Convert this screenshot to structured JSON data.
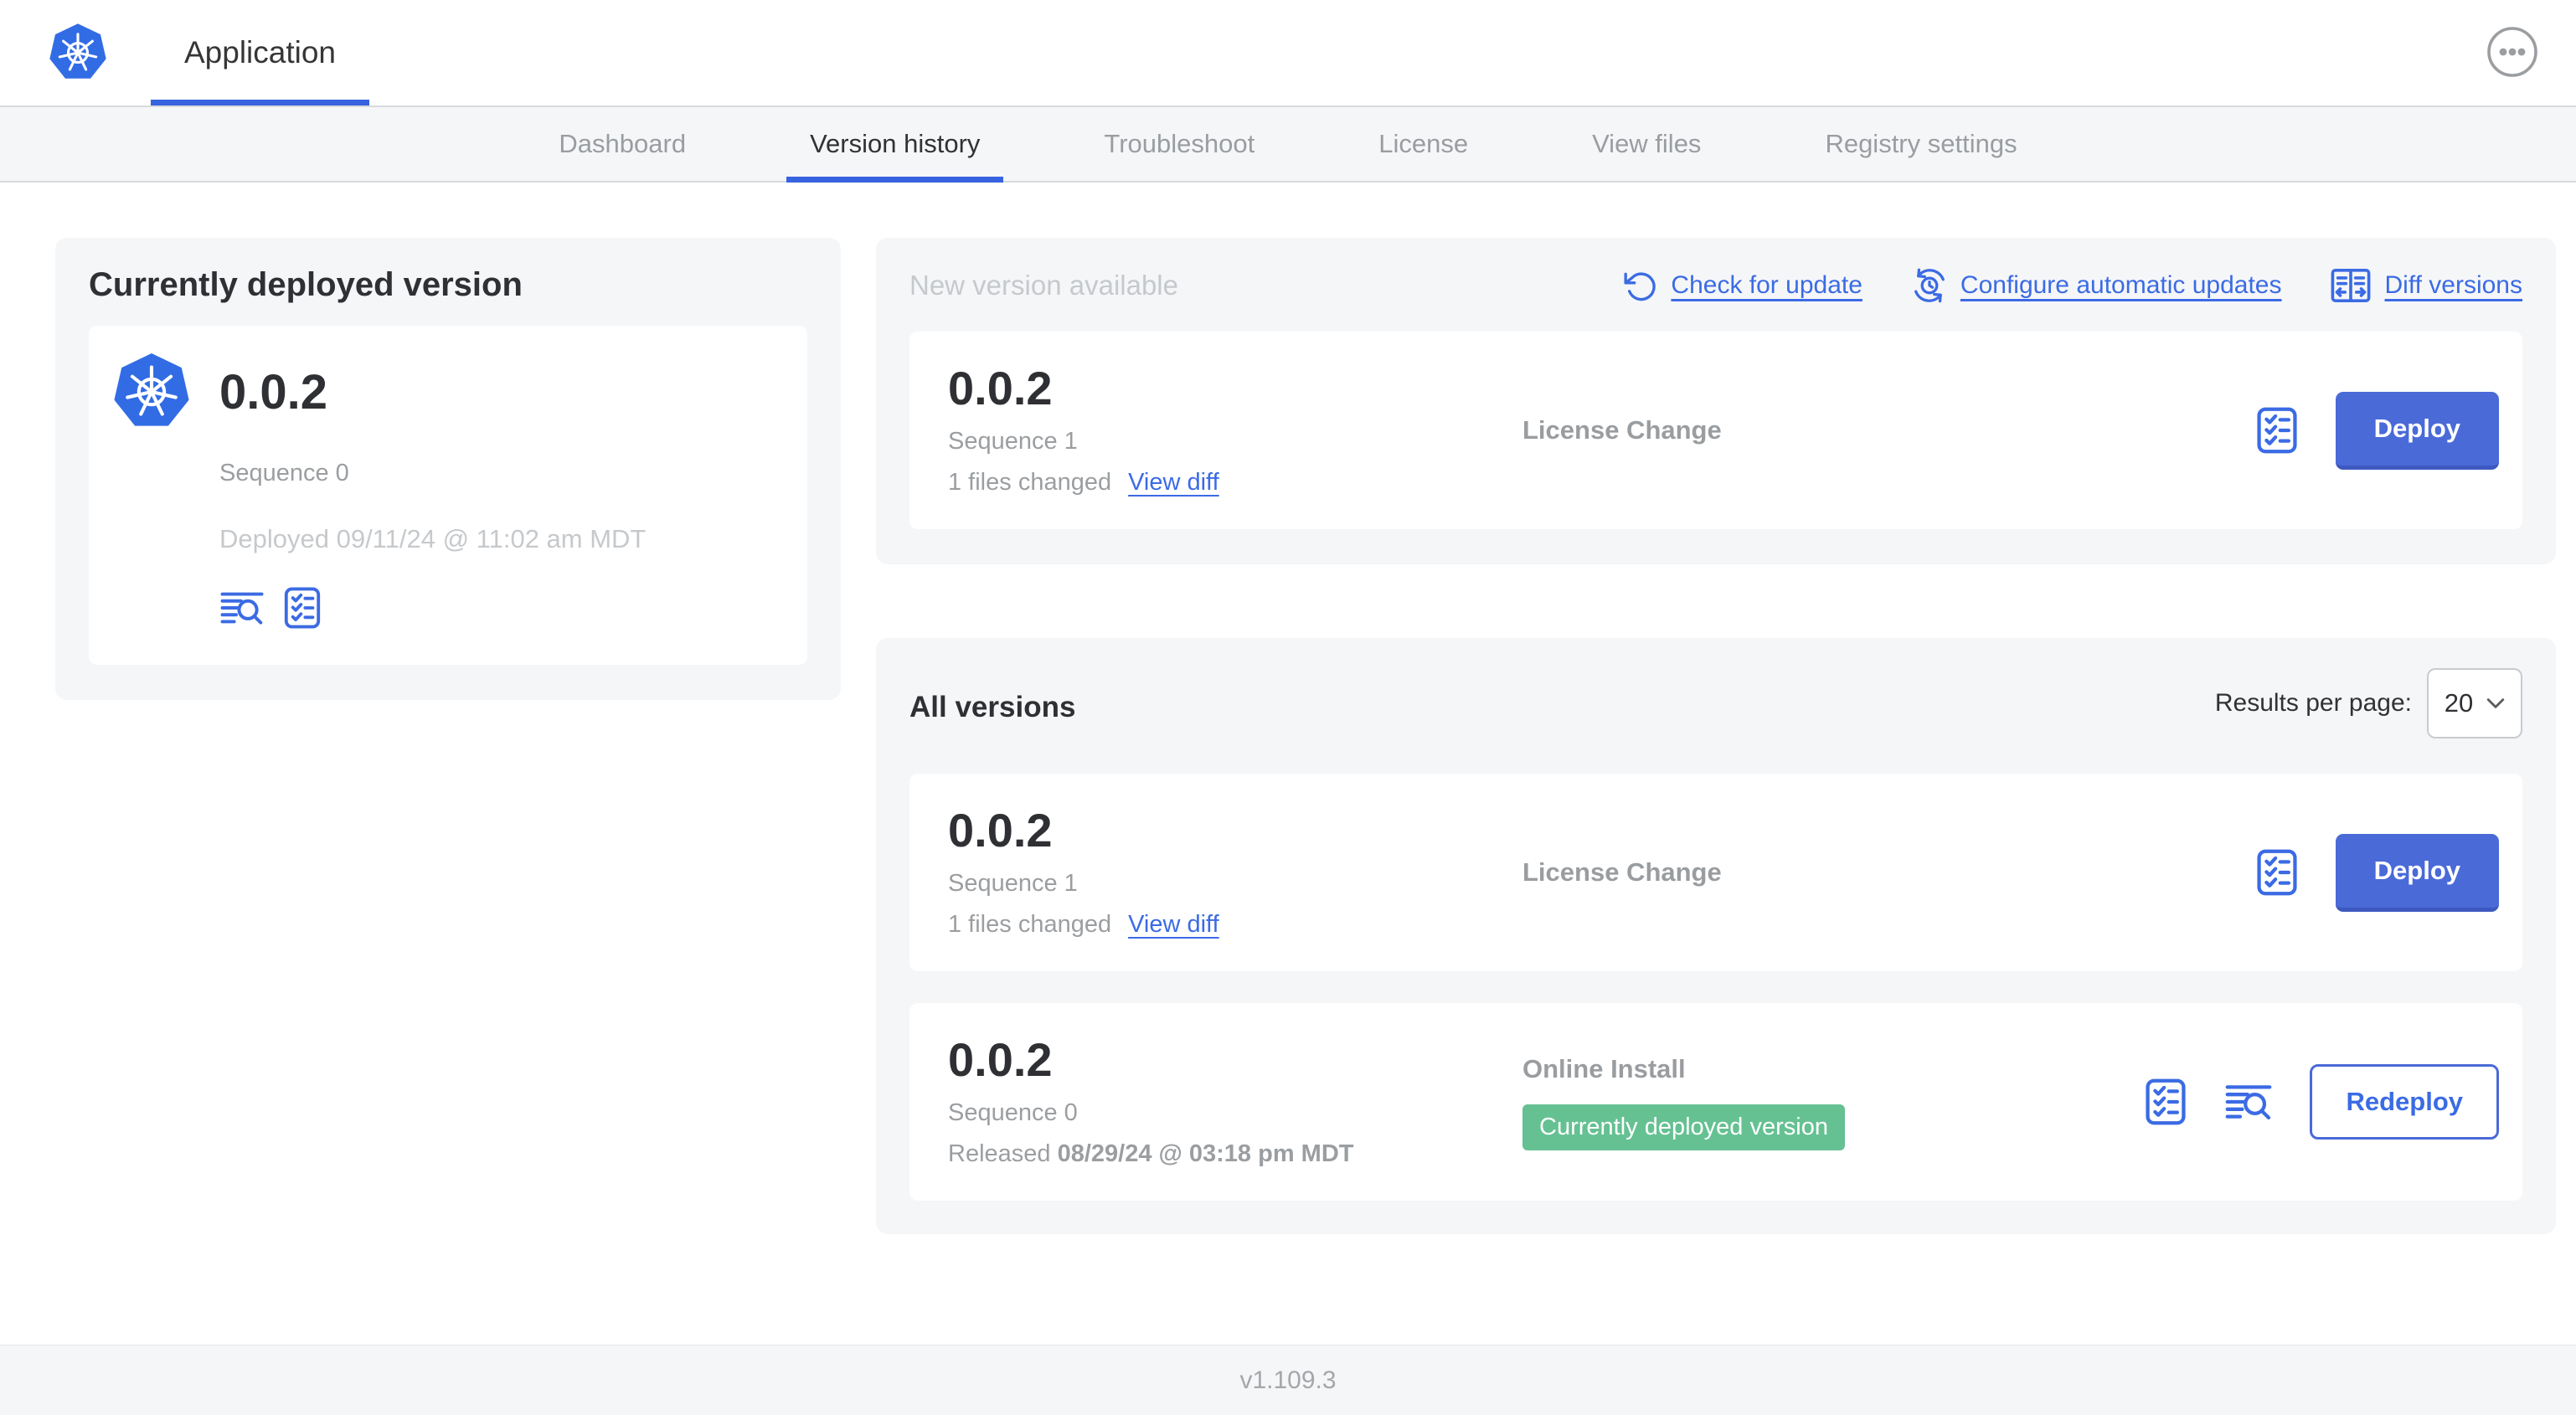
{
  "header": {
    "app_title": "Application",
    "menu_icon": "ellipsis-icon"
  },
  "nav": {
    "tabs": [
      {
        "label": "Dashboard",
        "active": false
      },
      {
        "label": "Version history",
        "active": true
      },
      {
        "label": "Troubleshoot",
        "active": false
      },
      {
        "label": "License",
        "active": false
      },
      {
        "label": "View files",
        "active": false
      },
      {
        "label": "Registry settings",
        "active": false
      }
    ]
  },
  "deployed_card": {
    "title": "Currently deployed version",
    "version": "0.0.2",
    "sequence": "Sequence 0",
    "deployed_at": "Deployed 09/11/24 @ 11:02 am MDT",
    "icons": [
      "view-logs-icon",
      "preflight-checks-icon"
    ]
  },
  "new_version": {
    "title": "New version available",
    "actions": [
      {
        "icon": "refresh-icon",
        "label": "Check for update"
      },
      {
        "icon": "schedule-update-icon",
        "label": "Configure automatic updates"
      },
      {
        "icon": "diff-icon",
        "label": "Diff versions"
      }
    ],
    "row": {
      "version": "0.0.2",
      "sequence": "Sequence 1",
      "files_changed": "1 files changed",
      "view_diff_label": "View diff",
      "source": "License Change",
      "action_label": "Deploy",
      "icons": [
        "preflight-checks-icon"
      ]
    }
  },
  "all_versions": {
    "title": "All versions",
    "results_per_page_label": "Results per page:",
    "results_per_page_value": "20",
    "rows": [
      {
        "version": "0.0.2",
        "sequence": "Sequence 1",
        "files_changed": "1 files changed",
        "view_diff_label": "View diff",
        "source": "License Change",
        "action_label": "Deploy",
        "icons": [
          "preflight-checks-icon"
        ]
      },
      {
        "version": "0.0.2",
        "sequence": "Sequence 0",
        "released_prefix": "Released ",
        "released_date": "08/29/24 @ 03:18 pm MDT",
        "source": "Online Install",
        "badge": "Currently deployed version",
        "action_label": "Redeploy",
        "icons": [
          "preflight-checks-icon",
          "view-logs-icon"
        ]
      }
    ]
  },
  "footer": {
    "app_version": "v1.109.3"
  },
  "colors": {
    "accent_blue": "#3b6be4",
    "button_blue": "#4a6ad8",
    "active_tab_underline": "#3763e0",
    "badge_green": "#65c192",
    "kubernetes_blue": "#326ce5",
    "panel_bg": "#f5f6f8",
    "text_dark": "#323232",
    "text_gray": "#9b9ea1",
    "text_light_gray": "#c6c9cc"
  }
}
